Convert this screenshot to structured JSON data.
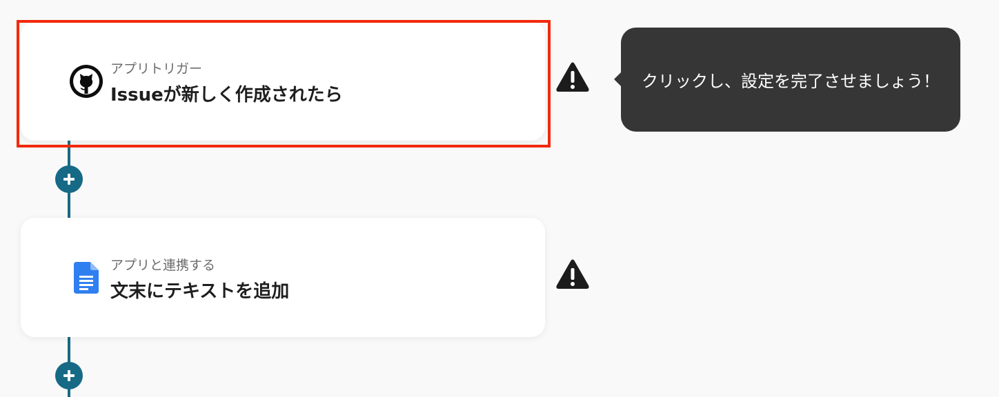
{
  "steps": [
    {
      "app_icon": "github-icon",
      "subtitle": "アプリトリガー",
      "title": "Issueが新しく作成されたら",
      "status_icon": "warning-icon",
      "highlighted": true
    },
    {
      "app_icon": "google-docs-icon",
      "subtitle": "アプリと連携する",
      "title": "文末にテキストを追加",
      "status_icon": "warning-icon",
      "highlighted": false
    }
  ],
  "tooltip": {
    "text": "クリックし、設定を完了させましょう！"
  },
  "add_button_icon": "plus-icon",
  "colors": {
    "accent": "#166a85",
    "highlight": "#f2290c",
    "tooltip_bg": "#363636",
    "background": "#f9f9f9"
  }
}
